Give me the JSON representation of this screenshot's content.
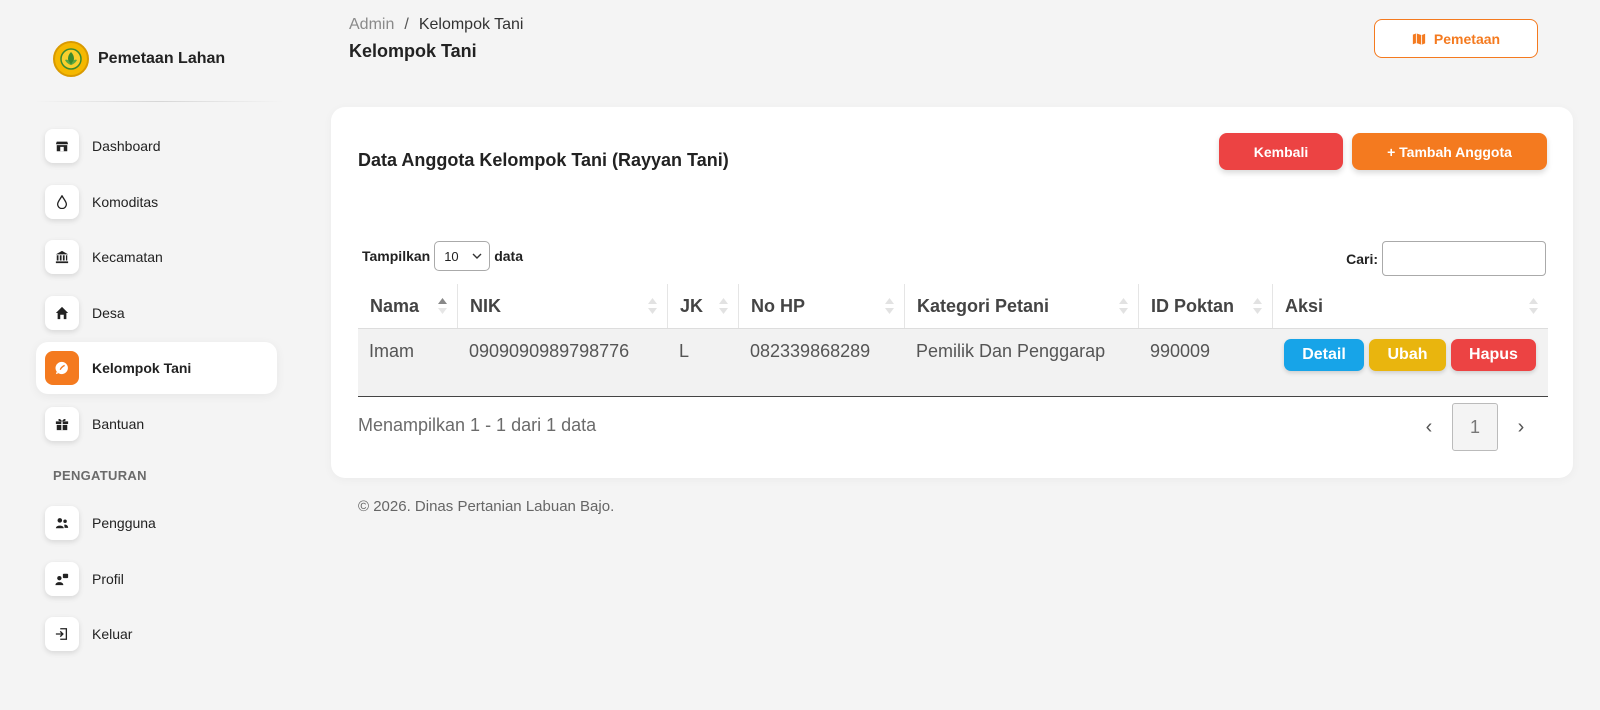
{
  "app": {
    "name": "Pemetaan Lahan"
  },
  "sidebar": {
    "items": [
      {
        "label": "Dashboard",
        "icon": "store-icon"
      },
      {
        "label": "Komoditas",
        "icon": "droplet-icon"
      },
      {
        "label": "Kecamatan",
        "icon": "bank-icon"
      },
      {
        "label": "Desa",
        "icon": "home-icon"
      },
      {
        "label": "Kelompok Tani",
        "icon": "leaf-icon",
        "active": true
      },
      {
        "label": "Bantuan",
        "icon": "gift-icon"
      }
    ],
    "section_label": "PENGATURAN",
    "settings_items": [
      {
        "label": "Pengguna",
        "icon": "users-icon"
      },
      {
        "label": "Profil",
        "icon": "profile-icon"
      },
      {
        "label": "Keluar",
        "icon": "logout-icon"
      }
    ]
  },
  "header": {
    "breadcrumb_parent": "Admin",
    "breadcrumb_sep": "/",
    "breadcrumb_current": "Kelompok Tani",
    "title": "Kelompok Tani",
    "map_button": "Pemetaan"
  },
  "card": {
    "title": "Data Anggota Kelompok Tani (Rayyan Tani)",
    "back_button": "Kembali",
    "add_button": "+ Tambah Anggota",
    "show_label": "Tampilkan",
    "show_value": "10",
    "show_suffix": "data",
    "search_label": "Cari:",
    "search_value": ""
  },
  "table": {
    "columns": [
      "Nama",
      "NIK",
      "JK",
      "No HP",
      "Kategori Petani",
      "ID Poktan",
      "Aksi"
    ],
    "rows": [
      {
        "nama": "Imam",
        "nik": "0909090989798776",
        "jk": "L",
        "no_hp": "082339868289",
        "kategori": "Pemilik Dan Penggarap",
        "id_poktan": "990009"
      }
    ],
    "actions": {
      "detail": "Detail",
      "edit": "Ubah",
      "delete": "Hapus"
    }
  },
  "pagination": {
    "info": "Menampilkan 1 - 1 dari 1 data",
    "prev": "‹",
    "page": "1",
    "next": "›"
  },
  "footer": {
    "text": "© 2026. Dinas Pertanian Labuan Bajo."
  },
  "colors": {
    "primary": "#f47a1f",
    "danger": "#ec4343",
    "info": "#17a4e8",
    "warning": "#e9b50e"
  }
}
